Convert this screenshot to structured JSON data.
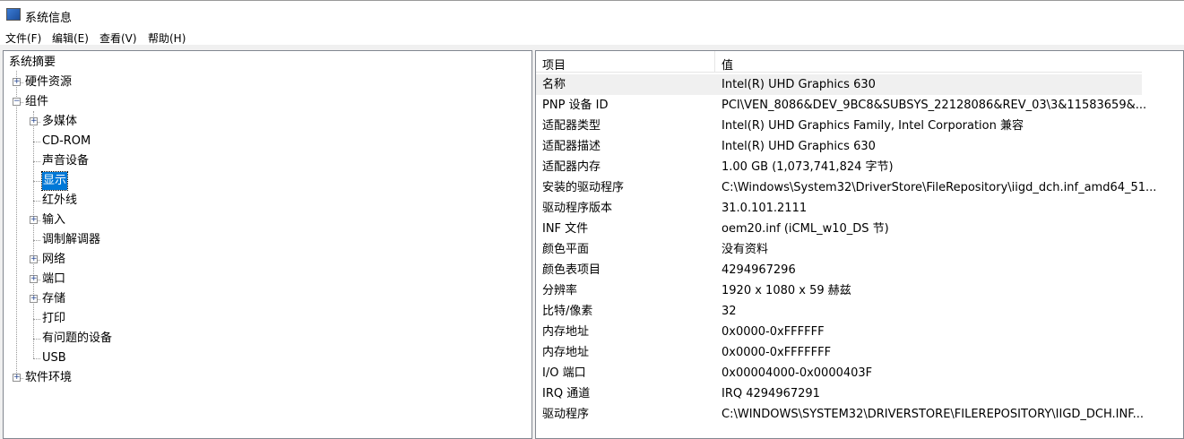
{
  "window": {
    "title": "系统信息",
    "icon": "system-info-icon"
  },
  "menu": [
    "文件(F)",
    "编辑(E)",
    "查看(V)",
    "帮助(H)"
  ],
  "tree": [
    {
      "label": "系统摘要",
      "level": 0,
      "expander": "none"
    },
    {
      "label": "硬件资源",
      "level": 1,
      "expander": "plus"
    },
    {
      "label": "组件",
      "level": 1,
      "expander": "minus"
    },
    {
      "label": "多媒体",
      "level": 2,
      "expander": "plus"
    },
    {
      "label": "CD-ROM",
      "level": 2,
      "expander": "none"
    },
    {
      "label": "声音设备",
      "level": 2,
      "expander": "none"
    },
    {
      "label": "显示",
      "level": 2,
      "expander": "none",
      "selected": true
    },
    {
      "label": "红外线",
      "level": 2,
      "expander": "none"
    },
    {
      "label": "输入",
      "level": 2,
      "expander": "plus"
    },
    {
      "label": "调制解调器",
      "level": 2,
      "expander": "none"
    },
    {
      "label": "网络",
      "level": 2,
      "expander": "plus"
    },
    {
      "label": "端口",
      "level": 2,
      "expander": "plus"
    },
    {
      "label": "存储",
      "level": 2,
      "expander": "plus"
    },
    {
      "label": "打印",
      "level": 2,
      "expander": "none"
    },
    {
      "label": "有问题的设备",
      "level": 2,
      "expander": "none"
    },
    {
      "label": "USB",
      "level": 2,
      "expander": "none"
    },
    {
      "label": "软件环境",
      "level": 1,
      "expander": "plus"
    }
  ],
  "table": {
    "headers": [
      "项目",
      "值"
    ],
    "rows": [
      [
        "名称",
        "Intel(R) UHD Graphics 630"
      ],
      [
        "PNP 设备 ID",
        "PCI\\VEN_8086&DEV_9BC8&SUBSYS_22128086&REV_03\\3&11583659&..."
      ],
      [
        "适配器类型",
        "Intel(R) UHD Graphics Family, Intel Corporation 兼容"
      ],
      [
        "适配器描述",
        "Intel(R) UHD Graphics 630"
      ],
      [
        "适配器内存",
        "1.00 GB (1,073,741,824 字节)"
      ],
      [
        "安装的驱动程序",
        "C:\\Windows\\System32\\DriverStore\\FileRepository\\iigd_dch.inf_amd64_51..."
      ],
      [
        "驱动程序版本",
        "31.0.101.2111"
      ],
      [
        "INF 文件",
        "oem20.inf (iCML_w10_DS 节)"
      ],
      [
        "颜色平面",
        "没有资料"
      ],
      [
        "颜色表项目",
        "4294967296"
      ],
      [
        "分辨率",
        "1920 x 1080 x 59 赫兹"
      ],
      [
        "比特/像素",
        "32"
      ],
      [
        "内存地址",
        "0x0000-0xFFFFFF"
      ],
      [
        "内存地址",
        "0x0000-0xFFFFFFF"
      ],
      [
        "I/O 端口",
        "0x00004000-0x0000403F"
      ],
      [
        "IRQ 通道",
        "IRQ 4294967291"
      ],
      [
        "驱动程序",
        "C:\\WINDOWS\\SYSTEM32\\DRIVERSTORE\\FILEREPOSITORY\\IIGD_DCH.INF..."
      ]
    ]
  }
}
